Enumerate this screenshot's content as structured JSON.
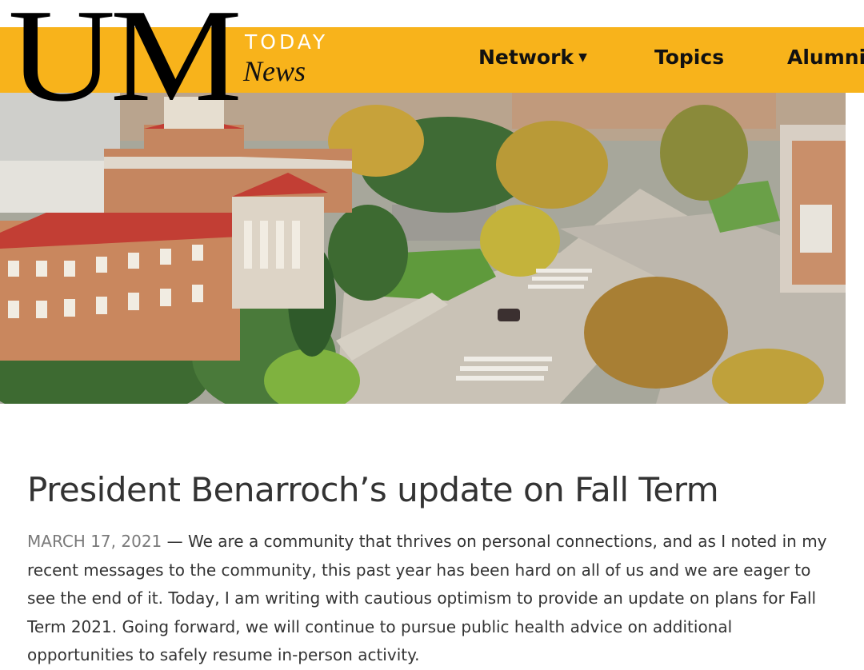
{
  "brand": {
    "logo_letters": "UM",
    "today": "TODAY",
    "news": "News"
  },
  "nav": {
    "network": "Network",
    "topics": "Topics",
    "alumni": "Alumni"
  },
  "colors": {
    "navbar": "#f8b31b",
    "text": "#333333",
    "date": "#7a7a7a"
  },
  "icons": {
    "network_dropdown": "caret-down-icon"
  },
  "hero": {
    "description_icon": "campus-aerial-photo"
  },
  "article": {
    "title": "President Benarroch’s update on Fall Term",
    "date": "MARCH 17, 2021",
    "separator": " — ",
    "body": "We are a community that thrives on personal connections, and as I noted in my recent messages to the community, this past year has been hard on all of us and we are eager to see the end of it. Today, I am writing with cautious optimism to provide an update on plans for Fall Term 2021. Going forward, we will continue to pursue public health advice on additional opportunities to safely resume in-person activity."
  }
}
